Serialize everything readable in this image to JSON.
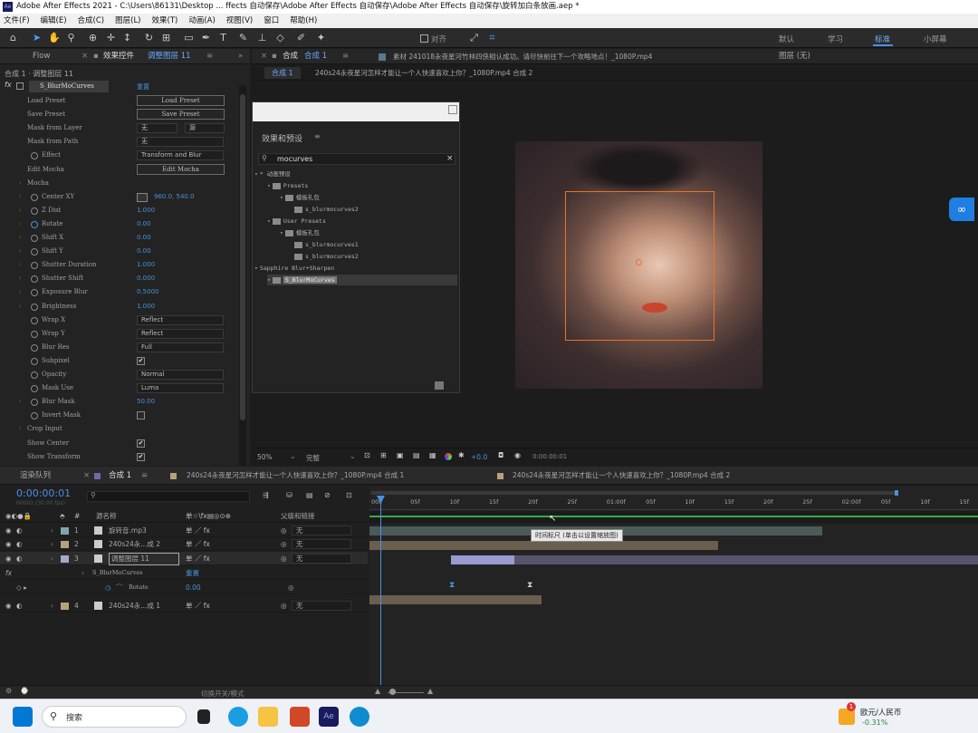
{
  "window": {
    "title": "Adobe After Effects 2021 - C:\\Users\\86131\\Desktop ... ffects 自动保存\\Adobe After Effects 自动保存\\Adobe After Effects 自动保存\\旋转加白条放画.aep *"
  },
  "menu": [
    "文件(F)",
    "编辑(E)",
    "合成(C)",
    "图层(L)",
    "效果(T)",
    "动画(A)",
    "视图(V)",
    "窗口",
    "帮助(H)"
  ],
  "toolbar": {
    "align_label": "对齐",
    "workspaces": [
      "默认",
      "学习",
      "标准",
      "小屏幕"
    ],
    "active_workspace": "标准"
  },
  "effects_panel": {
    "flow_tab": "Flow",
    "tab_label": "效果控件",
    "layer_name": "调整图层 11",
    "breadcrumb": "合成 1 · 调整图层 11",
    "effect_name": "S_BlurMoCurves",
    "reset": "重置",
    "rows": [
      {
        "label": "Load Preset",
        "type": "button",
        "value": "Load Preset"
      },
      {
        "label": "Save Preset",
        "type": "button",
        "value": "Save Preset"
      },
      {
        "label": "Mask from Layer",
        "type": "select2",
        "value": "无",
        "value2": "源"
      },
      {
        "label": "Mask from Path",
        "type": "select",
        "value": "无"
      },
      {
        "label": "Effect",
        "type": "select",
        "value": "Transform and Blur",
        "sw": true
      },
      {
        "label": "Edit Mocha",
        "type": "button",
        "value": "Edit Mocha"
      },
      {
        "label": "Mocha",
        "type": "group"
      },
      {
        "label": "Center XY",
        "type": "value",
        "value": "960.0, 540.0",
        "sw": true,
        "tw": true
      },
      {
        "label": "Z Dist",
        "type": "value",
        "value": "1.000",
        "sw": true,
        "tw": true
      },
      {
        "label": "Rotate",
        "type": "value",
        "value": "0.00",
        "sw": true,
        "tw": true,
        "active": true
      },
      {
        "label": "Shift X",
        "type": "value",
        "value": "0.00",
        "sw": true,
        "tw": true
      },
      {
        "label": "Shift Y",
        "type": "value",
        "value": "0.00",
        "sw": true,
        "tw": true
      },
      {
        "label": "Shutter Duration",
        "type": "value",
        "value": "1.000",
        "sw": true,
        "tw": true
      },
      {
        "label": "Shutter Shift",
        "type": "value",
        "value": "0.000",
        "sw": true,
        "tw": true
      },
      {
        "label": "Exposure Blur",
        "type": "value",
        "value": "0.5000",
        "sw": true,
        "tw": true
      },
      {
        "label": "Brightness",
        "type": "value",
        "value": "1.000",
        "sw": true,
        "tw": true
      },
      {
        "label": "Wrap X",
        "type": "select",
        "value": "Reflect",
        "sw": true
      },
      {
        "label": "Wrap Y",
        "type": "select",
        "value": "Reflect",
        "sw": true
      },
      {
        "label": "Blur Res",
        "type": "select",
        "value": "Full",
        "sw": true
      },
      {
        "label": "Subpixel",
        "type": "check",
        "value": "✔",
        "sw": true
      },
      {
        "label": "Opacity",
        "type": "select",
        "value": "Normal",
        "sw": true
      },
      {
        "label": "Mask Use",
        "type": "select",
        "value": "Luma",
        "sw": true
      },
      {
        "label": "Blur Mask",
        "type": "value",
        "value": "50.00",
        "sw": true,
        "tw": true
      },
      {
        "label": "Invert Mask",
        "type": "check",
        "value": "",
        "sw": true
      },
      {
        "label": "Crop Input",
        "type": "group"
      },
      {
        "label": "Show Center",
        "type": "check",
        "value": "✔"
      },
      {
        "label": "Show Transform",
        "type": "check",
        "value": "✔"
      }
    ]
  },
  "comp_panel": {
    "tab_label": "合成",
    "comp_name": "合成 1",
    "footage_label": "素材 241018永夜星河竹林四侠相认成功。请尽快前往下一个攻略地点！_1080P.mp4",
    "layer_label": "图层 (无)",
    "sub_tabs": [
      "合成 1",
      "240s24永夜星河怎样才能让一个人快速喜欢上你？_1080P.mp4 合成 2"
    ],
    "zoom": "50%",
    "quality": "完整",
    "timecode": "0:00:00:01",
    "exposure": "+0.0"
  },
  "effects_presets": {
    "title": "效果和预设",
    "search": "mocurves",
    "tree": [
      {
        "level": 0,
        "text": "* 动画预设",
        "icon": false
      },
      {
        "level": 1,
        "text": "Presets",
        "icon": true
      },
      {
        "level": 2,
        "text": "模板礼包",
        "icon": true
      },
      {
        "level": 3,
        "text": "s_blurmocurves2",
        "icon": true
      },
      {
        "level": 1,
        "text": "User Presets",
        "icon": true
      },
      {
        "level": 2,
        "text": "模板礼包",
        "icon": true
      },
      {
        "level": 3,
        "text": "s_blurmocurves1",
        "icon": true
      },
      {
        "level": 3,
        "text": "s_blurmocurves2",
        "icon": true
      },
      {
        "level": 0,
        "text": "Sapphire Blur+Sharpen",
        "icon": false
      },
      {
        "level": 1,
        "text": "S_BlurMoCurves",
        "icon": true,
        "selected": true
      }
    ]
  },
  "timeline": {
    "tabs": [
      "渲染队列",
      "合成 1",
      "240s24永夜星河怎样才能让一个人快速喜欢上你？_1080P.mp4 合成 1",
      "240s24永夜星河怎样才能让一个人快速喜欢上你？_1080P.mp4 合成 2"
    ],
    "timecode": "0:00:00:01",
    "fps": "00001 (30.00 fps)",
    "columns": {
      "name": "源名称",
      "parent": "父级和链接"
    },
    "layers": [
      {
        "num": "1",
        "name": "旋转音.mp3",
        "parent": "无",
        "color": "#7fa7a7"
      },
      {
        "num": "2",
        "name": "240s24永...成 2",
        "parent": "无",
        "color": "#b8a07a"
      },
      {
        "num": "3",
        "name": "调整图层 11",
        "parent": "无",
        "color": "#a8a8c8",
        "selected": true
      },
      {
        "num": "4",
        "name": "240s24永...成 1",
        "parent": "无",
        "color": "#b8a07a"
      }
    ],
    "effect_row": "S_BlurMoCurves",
    "effect_reset": "重置",
    "rotate_label": "Rotate",
    "rotate_value": "0.00",
    "ruler_ticks": [
      "00s",
      "05f",
      "10f",
      "15f",
      "20f",
      "25f",
      "01:00f",
      "05f",
      "10f",
      "15f",
      "20f",
      "25f",
      "02:00f",
      "05f",
      "10f",
      "15f"
    ],
    "tooltip": "时间标尺 (单击以设置缩放图)",
    "footer": "切换开关/模式"
  },
  "taskbar": {
    "search": "搜索",
    "stock_name": "欧元/人民币",
    "stock_change": "-0.31%",
    "badge": "1"
  }
}
